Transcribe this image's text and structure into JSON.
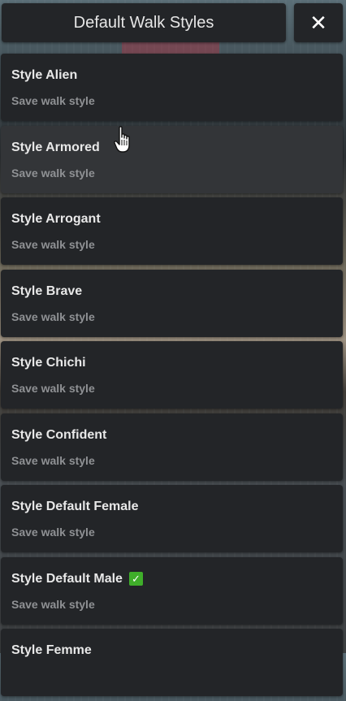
{
  "header": {
    "title": "Default Walk Styles",
    "close_label": "✕"
  },
  "items": [
    {
      "title": "Style Alien",
      "subtitle": "Save walk style",
      "selected": false
    },
    {
      "title": "Style Armored",
      "subtitle": "Save walk style",
      "selected": false
    },
    {
      "title": "Style Arrogant",
      "subtitle": "Save walk style",
      "selected": false
    },
    {
      "title": "Style Brave",
      "subtitle": "Save walk style",
      "selected": false
    },
    {
      "title": "Style Chichi",
      "subtitle": "Save walk style",
      "selected": false
    },
    {
      "title": "Style Confident",
      "subtitle": "Save walk style",
      "selected": false
    },
    {
      "title": "Style Default Female",
      "subtitle": "Save walk style",
      "selected": false
    },
    {
      "title": "Style Default Male",
      "subtitle": "Save walk style",
      "selected": true
    },
    {
      "title": "Style Femme",
      "subtitle": "",
      "selected": false
    }
  ],
  "hovered_item": "Style Armored",
  "colors": {
    "panel": "#232528",
    "panel_hover": "#333538",
    "title_text": "#e8e8e8",
    "subtitle_text": "#8f9194",
    "check": "#3fae2a"
  },
  "icons": {
    "close": "close-icon",
    "selected": "checkmark-icon",
    "pointer": "hand-pointer-icon"
  }
}
